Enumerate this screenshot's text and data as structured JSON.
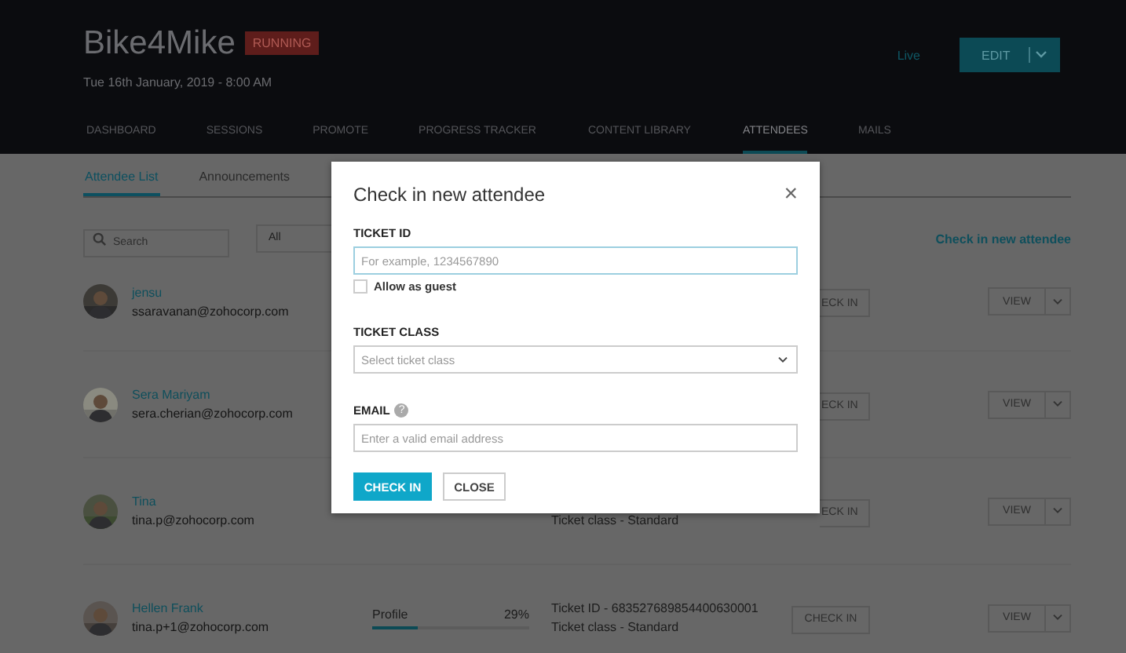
{
  "event": {
    "title": "Bike4Mike",
    "status": "RUNNING",
    "date": "Tue 16th January, 2019 - 8:00 AM",
    "live": "Live",
    "edit": "EDIT"
  },
  "tabs": [
    {
      "label": "DASHBOARD",
      "selected": false
    },
    {
      "label": "SESSIONS",
      "selected": false
    },
    {
      "label": "PROMOTE",
      "selected": false
    },
    {
      "label": "PROGRESS TRACKER",
      "selected": false
    },
    {
      "label": "CONTENT LIBRARY",
      "selected": false
    },
    {
      "label": "ATTENDEES",
      "selected": true
    },
    {
      "label": "MAILS",
      "selected": false
    }
  ],
  "subtabs": [
    {
      "label": "Attendee List",
      "selected": true
    },
    {
      "label": "Announcements",
      "selected": false
    }
  ],
  "search": {
    "placeholder": "Search"
  },
  "filter": {
    "value": "All"
  },
  "check_in_link": "Check in new attendee",
  "attendees": [
    {
      "name": "jensu",
      "email": "ssaravanan@zohocorp.com",
      "check_in": "ECK IN",
      "clipped": true,
      "view": "VIEW"
    },
    {
      "name": "Sera Mariyam",
      "email": "sera.cherian@zohocorp.com",
      "check_in": "ECK IN",
      "clipped": true,
      "view": "VIEW"
    },
    {
      "name": "Tina",
      "email": "tina.p@zohocorp.com",
      "ticket_class": "Ticket class - Standard",
      "check_in": "ECK IN",
      "clipped": true,
      "view": "VIEW"
    },
    {
      "name": "Hellen Frank",
      "email": "tina.p+1@zohocorp.com",
      "profile": {
        "label": "Profile",
        "percent": "29%",
        "level": 0.29
      },
      "ticket_id": "Ticket ID - 683527689854400630001",
      "ticket_class": "Ticket class - Standard",
      "check_in": "CHECK IN",
      "clipped": false,
      "view": "VIEW"
    }
  ],
  "dialog": {
    "title": "Check in new attendee",
    "close": "×",
    "ticket_id": {
      "label": "TICKET ID",
      "placeholder": "For example, 1234567890"
    },
    "guest": {
      "label": "Allow as guest",
      "checked": false
    },
    "ticket_class": {
      "label": "TICKET CLASS",
      "placeholder": "Select ticket class"
    },
    "email": {
      "label": "EMAIL",
      "help": "?",
      "placeholder": "Enter a valid email address"
    },
    "buttons": [
      {
        "label": "CHECK IN",
        "kind": "primary"
      },
      {
        "label": "CLOSE",
        "kind": "secondary"
      }
    ]
  }
}
